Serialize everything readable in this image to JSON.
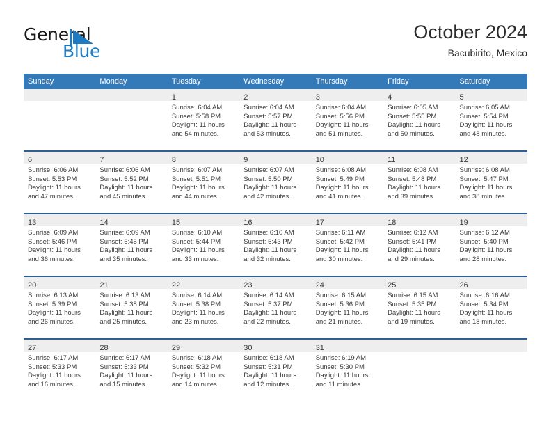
{
  "brand": {
    "name_part1": "General",
    "name_part2": "Blue",
    "mark": "triangle-flag-icon",
    "accent_color": "#1f7bc1"
  },
  "header": {
    "title": "October 2024",
    "subtitle": "Bacubirito, Mexico"
  },
  "colors": {
    "header_blue": "#3479b8",
    "row_divider_blue": "#2a6096",
    "daynum_band": "#eeeeee",
    "text": "#3a3a3a"
  },
  "weekdays": [
    "Sunday",
    "Monday",
    "Tuesday",
    "Wednesday",
    "Thursday",
    "Friday",
    "Saturday"
  ],
  "weeks": [
    [
      {
        "day": ""
      },
      {
        "day": ""
      },
      {
        "day": "1",
        "sunrise": "Sunrise: 6:04 AM",
        "sunset": "Sunset: 5:58 PM",
        "daylight_line1": "Daylight: 11 hours",
        "daylight_line2": "and 54 minutes."
      },
      {
        "day": "2",
        "sunrise": "Sunrise: 6:04 AM",
        "sunset": "Sunset: 5:57 PM",
        "daylight_line1": "Daylight: 11 hours",
        "daylight_line2": "and 53 minutes."
      },
      {
        "day": "3",
        "sunrise": "Sunrise: 6:04 AM",
        "sunset": "Sunset: 5:56 PM",
        "daylight_line1": "Daylight: 11 hours",
        "daylight_line2": "and 51 minutes."
      },
      {
        "day": "4",
        "sunrise": "Sunrise: 6:05 AM",
        "sunset": "Sunset: 5:55 PM",
        "daylight_line1": "Daylight: 11 hours",
        "daylight_line2": "and 50 minutes."
      },
      {
        "day": "5",
        "sunrise": "Sunrise: 6:05 AM",
        "sunset": "Sunset: 5:54 PM",
        "daylight_line1": "Daylight: 11 hours",
        "daylight_line2": "and 48 minutes."
      }
    ],
    [
      {
        "day": "6",
        "sunrise": "Sunrise: 6:06 AM",
        "sunset": "Sunset: 5:53 PM",
        "daylight_line1": "Daylight: 11 hours",
        "daylight_line2": "and 47 minutes."
      },
      {
        "day": "7",
        "sunrise": "Sunrise: 6:06 AM",
        "sunset": "Sunset: 5:52 PM",
        "daylight_line1": "Daylight: 11 hours",
        "daylight_line2": "and 45 minutes."
      },
      {
        "day": "8",
        "sunrise": "Sunrise: 6:07 AM",
        "sunset": "Sunset: 5:51 PM",
        "daylight_line1": "Daylight: 11 hours",
        "daylight_line2": "and 44 minutes."
      },
      {
        "day": "9",
        "sunrise": "Sunrise: 6:07 AM",
        "sunset": "Sunset: 5:50 PM",
        "daylight_line1": "Daylight: 11 hours",
        "daylight_line2": "and 42 minutes."
      },
      {
        "day": "10",
        "sunrise": "Sunrise: 6:08 AM",
        "sunset": "Sunset: 5:49 PM",
        "daylight_line1": "Daylight: 11 hours",
        "daylight_line2": "and 41 minutes."
      },
      {
        "day": "11",
        "sunrise": "Sunrise: 6:08 AM",
        "sunset": "Sunset: 5:48 PM",
        "daylight_line1": "Daylight: 11 hours",
        "daylight_line2": "and 39 minutes."
      },
      {
        "day": "12",
        "sunrise": "Sunrise: 6:08 AM",
        "sunset": "Sunset: 5:47 PM",
        "daylight_line1": "Daylight: 11 hours",
        "daylight_line2": "and 38 minutes."
      }
    ],
    [
      {
        "day": "13",
        "sunrise": "Sunrise: 6:09 AM",
        "sunset": "Sunset: 5:46 PM",
        "daylight_line1": "Daylight: 11 hours",
        "daylight_line2": "and 36 minutes."
      },
      {
        "day": "14",
        "sunrise": "Sunrise: 6:09 AM",
        "sunset": "Sunset: 5:45 PM",
        "daylight_line1": "Daylight: 11 hours",
        "daylight_line2": "and 35 minutes."
      },
      {
        "day": "15",
        "sunrise": "Sunrise: 6:10 AM",
        "sunset": "Sunset: 5:44 PM",
        "daylight_line1": "Daylight: 11 hours",
        "daylight_line2": "and 33 minutes."
      },
      {
        "day": "16",
        "sunrise": "Sunrise: 6:10 AM",
        "sunset": "Sunset: 5:43 PM",
        "daylight_line1": "Daylight: 11 hours",
        "daylight_line2": "and 32 minutes."
      },
      {
        "day": "17",
        "sunrise": "Sunrise: 6:11 AM",
        "sunset": "Sunset: 5:42 PM",
        "daylight_line1": "Daylight: 11 hours",
        "daylight_line2": "and 30 minutes."
      },
      {
        "day": "18",
        "sunrise": "Sunrise: 6:12 AM",
        "sunset": "Sunset: 5:41 PM",
        "daylight_line1": "Daylight: 11 hours",
        "daylight_line2": "and 29 minutes."
      },
      {
        "day": "19",
        "sunrise": "Sunrise: 6:12 AM",
        "sunset": "Sunset: 5:40 PM",
        "daylight_line1": "Daylight: 11 hours",
        "daylight_line2": "and 28 minutes."
      }
    ],
    [
      {
        "day": "20",
        "sunrise": "Sunrise: 6:13 AM",
        "sunset": "Sunset: 5:39 PM",
        "daylight_line1": "Daylight: 11 hours",
        "daylight_line2": "and 26 minutes."
      },
      {
        "day": "21",
        "sunrise": "Sunrise: 6:13 AM",
        "sunset": "Sunset: 5:38 PM",
        "daylight_line1": "Daylight: 11 hours",
        "daylight_line2": "and 25 minutes."
      },
      {
        "day": "22",
        "sunrise": "Sunrise: 6:14 AM",
        "sunset": "Sunset: 5:38 PM",
        "daylight_line1": "Daylight: 11 hours",
        "daylight_line2": "and 23 minutes."
      },
      {
        "day": "23",
        "sunrise": "Sunrise: 6:14 AM",
        "sunset": "Sunset: 5:37 PM",
        "daylight_line1": "Daylight: 11 hours",
        "daylight_line2": "and 22 minutes."
      },
      {
        "day": "24",
        "sunrise": "Sunrise: 6:15 AM",
        "sunset": "Sunset: 5:36 PM",
        "daylight_line1": "Daylight: 11 hours",
        "daylight_line2": "and 21 minutes."
      },
      {
        "day": "25",
        "sunrise": "Sunrise: 6:15 AM",
        "sunset": "Sunset: 5:35 PM",
        "daylight_line1": "Daylight: 11 hours",
        "daylight_line2": "and 19 minutes."
      },
      {
        "day": "26",
        "sunrise": "Sunrise: 6:16 AM",
        "sunset": "Sunset: 5:34 PM",
        "daylight_line1": "Daylight: 11 hours",
        "daylight_line2": "and 18 minutes."
      }
    ],
    [
      {
        "day": "27",
        "sunrise": "Sunrise: 6:17 AM",
        "sunset": "Sunset: 5:33 PM",
        "daylight_line1": "Daylight: 11 hours",
        "daylight_line2": "and 16 minutes."
      },
      {
        "day": "28",
        "sunrise": "Sunrise: 6:17 AM",
        "sunset": "Sunset: 5:33 PM",
        "daylight_line1": "Daylight: 11 hours",
        "daylight_line2": "and 15 minutes."
      },
      {
        "day": "29",
        "sunrise": "Sunrise: 6:18 AM",
        "sunset": "Sunset: 5:32 PM",
        "daylight_line1": "Daylight: 11 hours",
        "daylight_line2": "and 14 minutes."
      },
      {
        "day": "30",
        "sunrise": "Sunrise: 6:18 AM",
        "sunset": "Sunset: 5:31 PM",
        "daylight_line1": "Daylight: 11 hours",
        "daylight_line2": "and 12 minutes."
      },
      {
        "day": "31",
        "sunrise": "Sunrise: 6:19 AM",
        "sunset": "Sunset: 5:30 PM",
        "daylight_line1": "Daylight: 11 hours",
        "daylight_line2": "and 11 minutes."
      },
      {
        "day": ""
      },
      {
        "day": ""
      }
    ]
  ]
}
